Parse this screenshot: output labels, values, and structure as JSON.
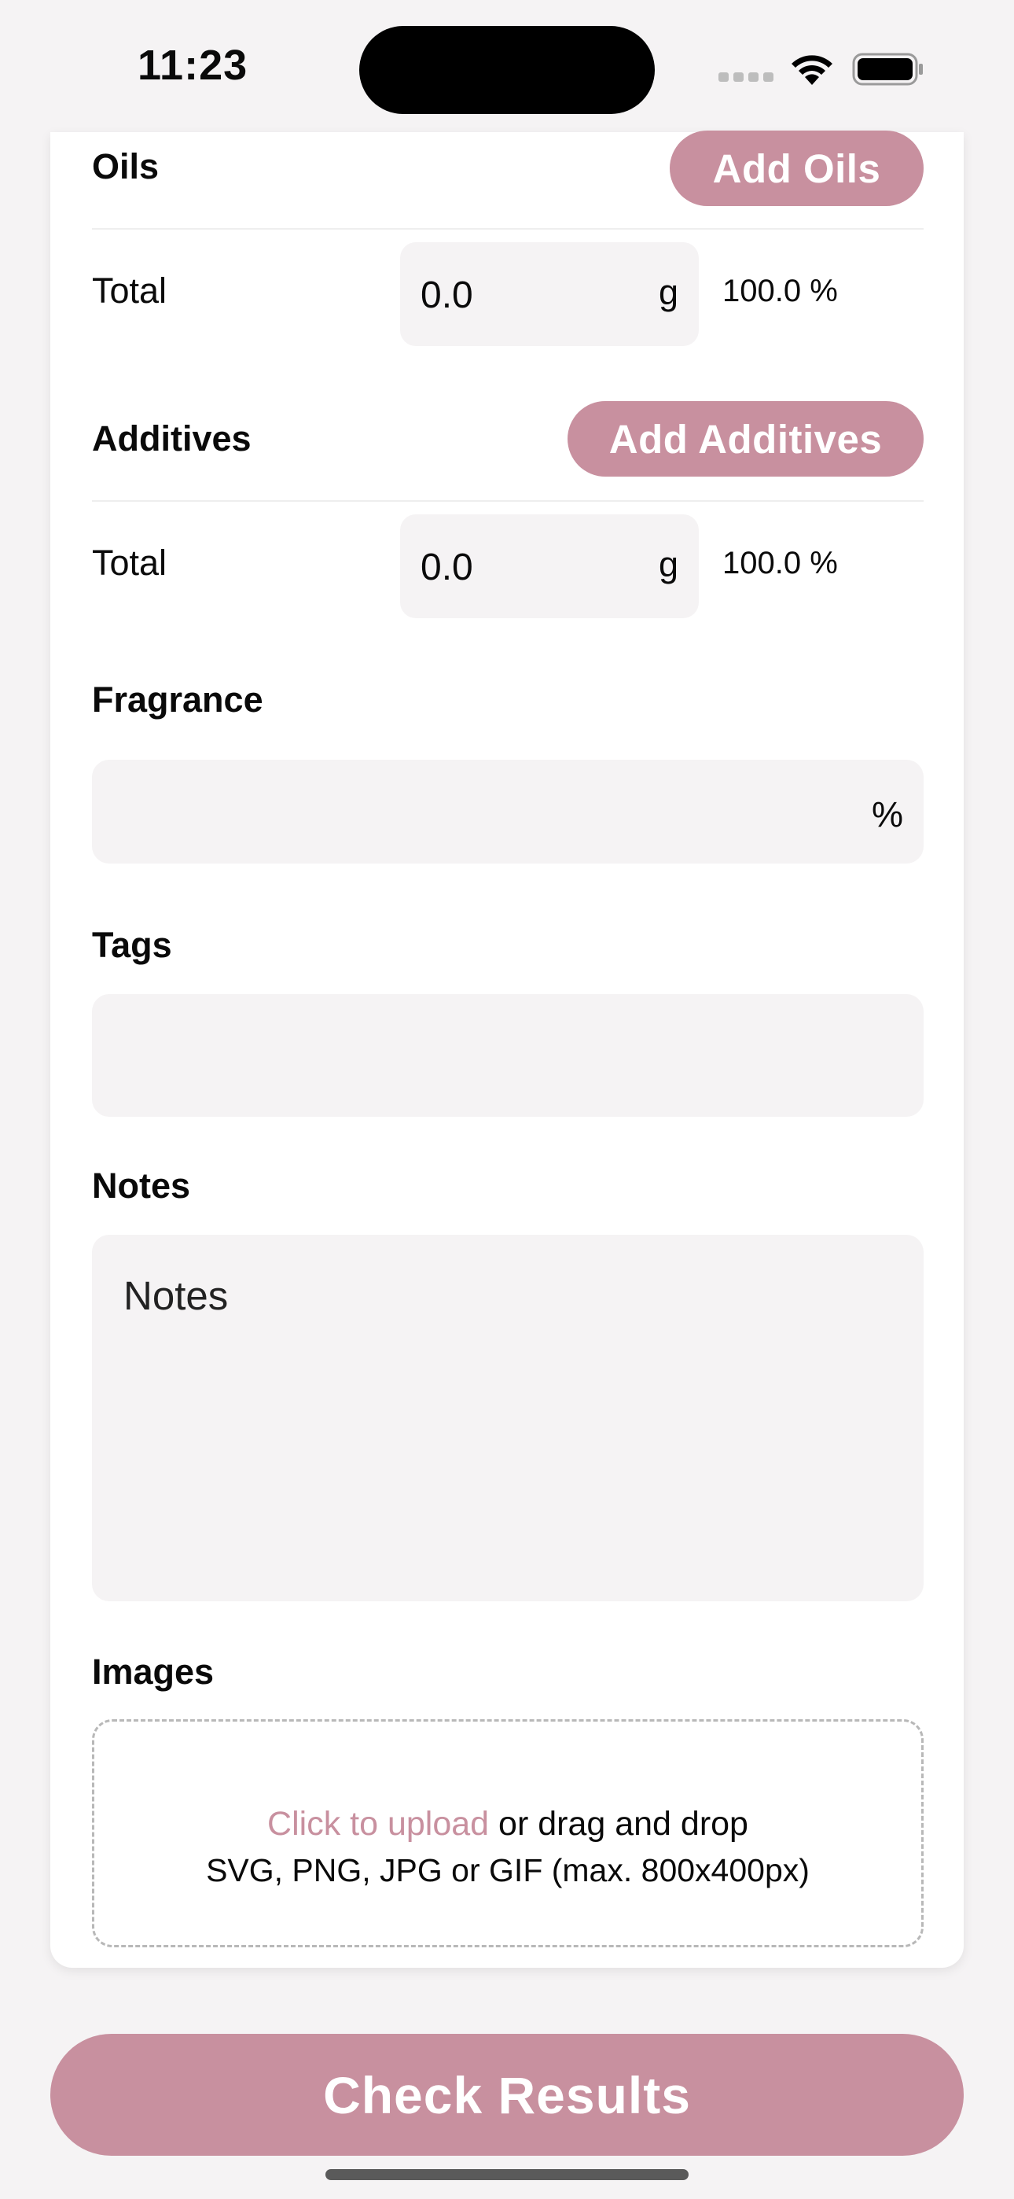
{
  "status_bar": {
    "time": "11:23"
  },
  "oils": {
    "heading": "Oils",
    "add_button": "Add Oils",
    "total_label": "Total",
    "total_value": "0.0",
    "total_unit": "g",
    "total_percent": "100.0 %"
  },
  "additives": {
    "heading": "Additives",
    "add_button": "Add Additives",
    "total_label": "Total",
    "total_value": "0.0",
    "total_unit": "g",
    "total_percent": "100.0 %"
  },
  "fragrance": {
    "heading": "Fragrance",
    "value": "",
    "suffix": "%"
  },
  "tags": {
    "heading": "Tags",
    "value": ""
  },
  "notes": {
    "heading": "Notes",
    "placeholder": "Notes"
  },
  "images": {
    "heading": "Images",
    "upload_link": "Click to upload",
    "upload_rest": " or drag and drop",
    "hint": "SVG, PNG, JPG or GIF (max. 800x400px)"
  },
  "actions": {
    "check_results": "Check Results"
  },
  "colors": {
    "accent": "#c8909f",
    "field_bg": "#f5f3f4",
    "card_bg": "#ffffff"
  }
}
